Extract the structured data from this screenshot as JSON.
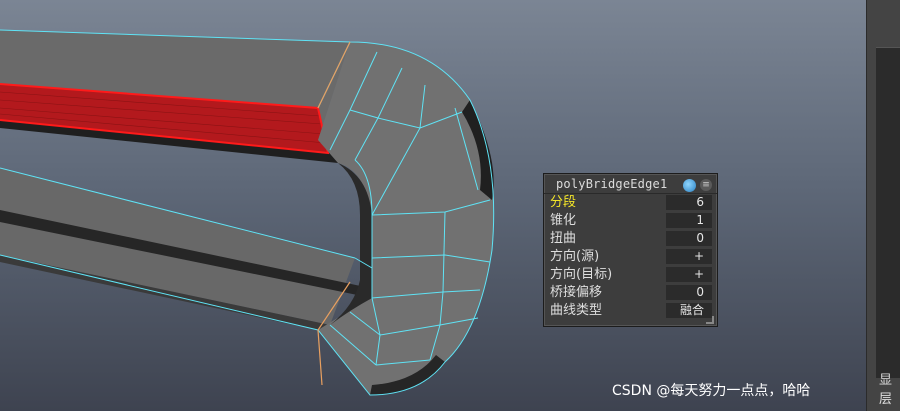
{
  "node": {
    "name": "polyBridgeEdge1",
    "attributes": [
      {
        "label": "分段",
        "value": "6",
        "highlighted": true
      },
      {
        "label": "锥化",
        "value": "1",
        "highlighted": false
      },
      {
        "label": "扭曲",
        "value": "0",
        "highlighted": false
      },
      {
        "label": "方向(源)",
        "value": "+",
        "highlighted": false
      },
      {
        "label": "方向(目标)",
        "value": "+",
        "highlighted": false
      },
      {
        "label": "桥接偏移",
        "value": "0",
        "highlighted": false
      },
      {
        "label": "曲线类型",
        "value": "融合",
        "highlighted": false
      }
    ]
  },
  "dock": {
    "tab_top": "显",
    "tab_bottom": "层"
  },
  "watermark": "CSDN @每天努力一点点，哈哈",
  "colors": {
    "wireframe": "#5fe3f5",
    "selected_edge": "#e01010",
    "selected_face": "#c01818",
    "highlight_label": "#f4e628"
  }
}
